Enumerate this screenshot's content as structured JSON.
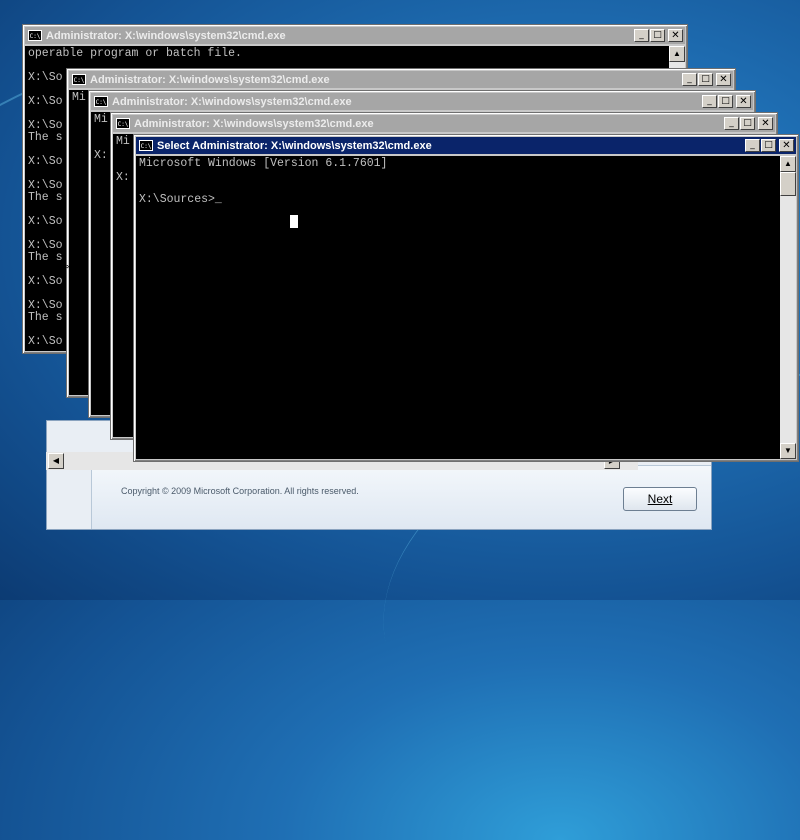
{
  "windows": [
    {
      "title": "Administrator: X:\\windows\\system32\\cmd.exe",
      "lines": [
        "operable program or batch file.",
        "",
        "X:\\So",
        "",
        "X:\\So",
        "",
        "X:\\So",
        "The s",
        "",
        "X:\\So",
        "",
        "X:\\So",
        "The s",
        "",
        "X:\\So",
        "",
        "X:\\So",
        "The s",
        "",
        "X:\\So",
        "",
        "X:\\So",
        "The s",
        "",
        "X:\\So"
      ]
    },
    {
      "title": "Administrator: X:\\windows\\system32\\cmd.exe",
      "lines": [
        "Mi"
      ]
    },
    {
      "title": "Administrator: X:\\windows\\system32\\cmd.exe",
      "lines": [
        "Mi",
        "",
        "",
        "X:"
      ]
    },
    {
      "title": "Administrator: X:\\windows\\system32\\cmd.exe",
      "lines": [
        "Mi",
        "",
        "",
        "X:"
      ]
    },
    {
      "title": "Select Administrator: X:\\windows\\system32\\cmd.exe",
      "lines": [
        "Microsoft Windows [Version 6.1.7601]",
        "",
        "",
        "X:\\Sources>_"
      ]
    }
  ],
  "setup": {
    "copyright": "Copyright © 2009 Microsoft Corporation. All rights reserved.",
    "next_label": "Next"
  },
  "icons": {
    "cmd": "cmd-window-icon",
    "minimize": "minimize-icon",
    "maximize": "maximize-icon",
    "close": "close-icon",
    "resize_cursor": "resize-horizontal-cursor-icon"
  },
  "colors": {
    "console_bg": "#000000",
    "console_text": "#c0c0c0",
    "active_titlebar": "#0a246a",
    "inactive_titlebar": "#a6a6a6"
  }
}
